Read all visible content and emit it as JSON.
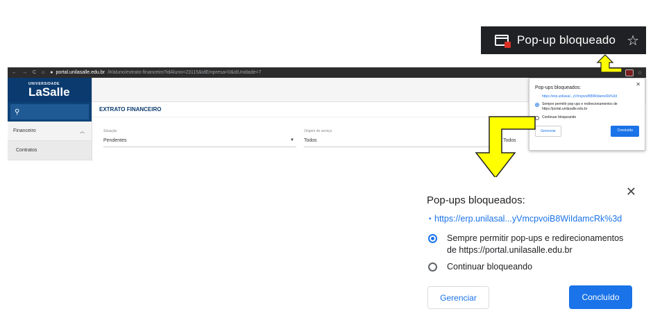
{
  "chip": {
    "label": "Pop-up bloqueado",
    "icon": "popup-blocked-icon",
    "star_icon": "star-icon"
  },
  "browser": {
    "url_host": "portal.unilasalle.edu.br",
    "url_path": "/#/aluno/extrato-financeiro?idAluno=23115&idEmpresa=0&idUnidade=7"
  },
  "app": {
    "logo_top": "UNIVERSIDADE",
    "logo_name": "LaSalle",
    "menu": [
      {
        "label": "Financeiro"
      },
      {
        "label": "Contratos"
      }
    ],
    "page_title": "EXTRATO FINANCEIRO",
    "filters": [
      {
        "label": "Situação",
        "value": "Pendentes"
      },
      {
        "label": "Origem do serviço",
        "value": "Todos"
      },
      {
        "label": "",
        "value": "Todos"
      }
    ]
  },
  "popup": {
    "title": "Pop-ups bloqueados:",
    "link": "https://erp.unilasal...yVmcpvoiB8WiIdamcRk%3d",
    "option_allow": "Sempre permitir pop-ups e redirecionamentos de https://portal.unilasalle.edu.br",
    "option_allow_line1": "Sempre permitir pop-ups e redirecionamentos",
    "option_allow_line2": "de https://portal.unilasalle.edu.br",
    "option_block": "Continuar bloqueando",
    "manage_label": "Gerenciar",
    "done_label": "Concluído",
    "close_symbol": "✕"
  },
  "colors": {
    "accent": "#1a73e8",
    "callout": "#ffff00",
    "dark_chip": "#202124",
    "brand": "#0b3a6e"
  }
}
